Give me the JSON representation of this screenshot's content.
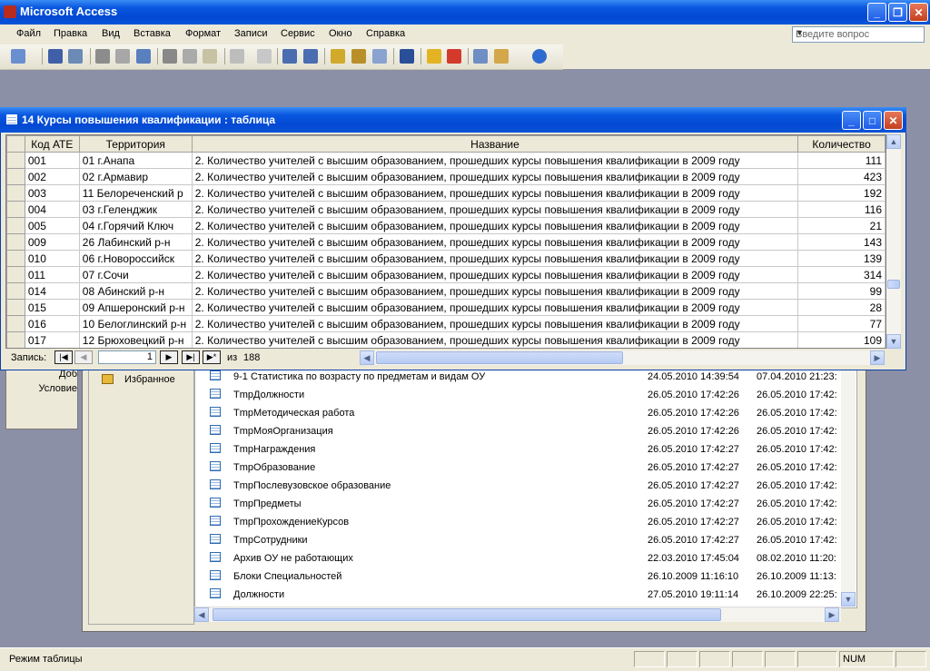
{
  "app": {
    "title": "Microsoft Access",
    "window_buttons": {
      "minimize": "_",
      "restore": "❐",
      "close": "✕"
    }
  },
  "menu": {
    "items": [
      "Файл",
      "Правка",
      "Вид",
      "Вставка",
      "Формат",
      "Записи",
      "Сервис",
      "Окно",
      "Справка"
    ],
    "ask_placeholder": "Введите вопрос"
  },
  "table_window": {
    "title": "14 Курсы повышения квалификации : таблица",
    "columns": [
      "Код АТЕ",
      "Территория",
      "Название",
      "Количество"
    ],
    "rows": [
      [
        "001",
        "01 г.Анапа",
        "2. Количество учителей с высшим образованием, прошедших  курсы повышения квалификации в 2009 году",
        "111"
      ],
      [
        "002",
        "02 г.Армавир",
        "2. Количество учителей с высшим образованием, прошедших  курсы повышения квалификации в 2009 году",
        "423"
      ],
      [
        "003",
        "11 Белореченский р",
        "2. Количество учителей с высшим образованием, прошедших  курсы повышения квалификации в 2009 году",
        "192"
      ],
      [
        "004",
        "03 г.Геленджик",
        "2. Количество учителей с высшим образованием, прошедших  курсы повышения квалификации в 2009 году",
        "116"
      ],
      [
        "005",
        "04 г.Горячий Ключ",
        "2. Количество учителей с высшим образованием, прошедших  курсы повышения квалификации в 2009 году",
        "21"
      ],
      [
        "009",
        "26 Лабинский р-н",
        "2. Количество учителей с высшим образованием, прошедших  курсы повышения квалификации в 2009 году",
        "143"
      ],
      [
        "010",
        "06 г.Новороссийск",
        "2. Количество учителей с высшим образованием, прошедших  курсы повышения квалификации в 2009 году",
        "139"
      ],
      [
        "011",
        "07 г.Сочи",
        "2. Количество учителей с высшим образованием, прошедших  курсы повышения квалификации в 2009 году",
        "314"
      ],
      [
        "014",
        "08 Абинский р-н",
        "2. Количество учителей с высшим образованием, прошедших  курсы повышения квалификации в 2009 году",
        "99"
      ],
      [
        "015",
        "09 Апшеронский р-н",
        "2. Количество учителей с высшим образованием, прошедших  курсы повышения квалификации в 2009 году",
        "28"
      ],
      [
        "016",
        "10 Белоглинский р-н",
        "2. Количество учителей с высшим образованием, прошедших  курсы повышения квалификации в 2009 году",
        "77"
      ],
      [
        "017",
        "12 Брюховецкий р-н",
        "2. Количество учителей с высшим образованием, прошедших  курсы повышения квалификации в 2009 году",
        "109"
      ]
    ],
    "nav": {
      "label": "Запись:",
      "current": "1",
      "of_label": "из",
      "total": "188"
    }
  },
  "db_window": {
    "left_labels": [
      "Доб",
      "Условие"
    ],
    "favorites": "Избранное",
    "items": [
      [
        "9-1 Статистика по возрасту по предметам и видам ОУ",
        "24.05.2010 14:39:54",
        "07.04.2010 21:23:"
      ],
      [
        "TmpДолжности",
        "26.05.2010 17:42:26",
        "26.05.2010 17:42:"
      ],
      [
        "TmpМетодическая работа",
        "26.05.2010 17:42:26",
        "26.05.2010 17:42:"
      ],
      [
        "TmpМояОрганизация",
        "26.05.2010 17:42:26",
        "26.05.2010 17:42:"
      ],
      [
        "TmpНаграждения",
        "26.05.2010 17:42:27",
        "26.05.2010 17:42:"
      ],
      [
        "TmpОбразование",
        "26.05.2010 17:42:27",
        "26.05.2010 17:42:"
      ],
      [
        "TmpПослевузовское образование",
        "26.05.2010 17:42:27",
        "26.05.2010 17:42:"
      ],
      [
        "TmpПредметы",
        "26.05.2010 17:42:27",
        "26.05.2010 17:42:"
      ],
      [
        "TmpПрохождениеКурсов",
        "26.05.2010 17:42:27",
        "26.05.2010 17:42:"
      ],
      [
        "TmpСотрудники",
        "26.05.2010 17:42:27",
        "26.05.2010 17:42:"
      ],
      [
        "Архив ОУ не работающих",
        "22.03.2010 17:45:04",
        "08.02.2010 11:20:"
      ],
      [
        "Блоки Специальностей",
        "26.10.2009 11:16:10",
        "26.10.2009 11:13:"
      ],
      [
        "Должности",
        "27.05.2010 19:11:14",
        "26.10.2009 22:25:"
      ]
    ]
  },
  "status": {
    "mode": "Режим таблицы",
    "num": "NUM"
  }
}
